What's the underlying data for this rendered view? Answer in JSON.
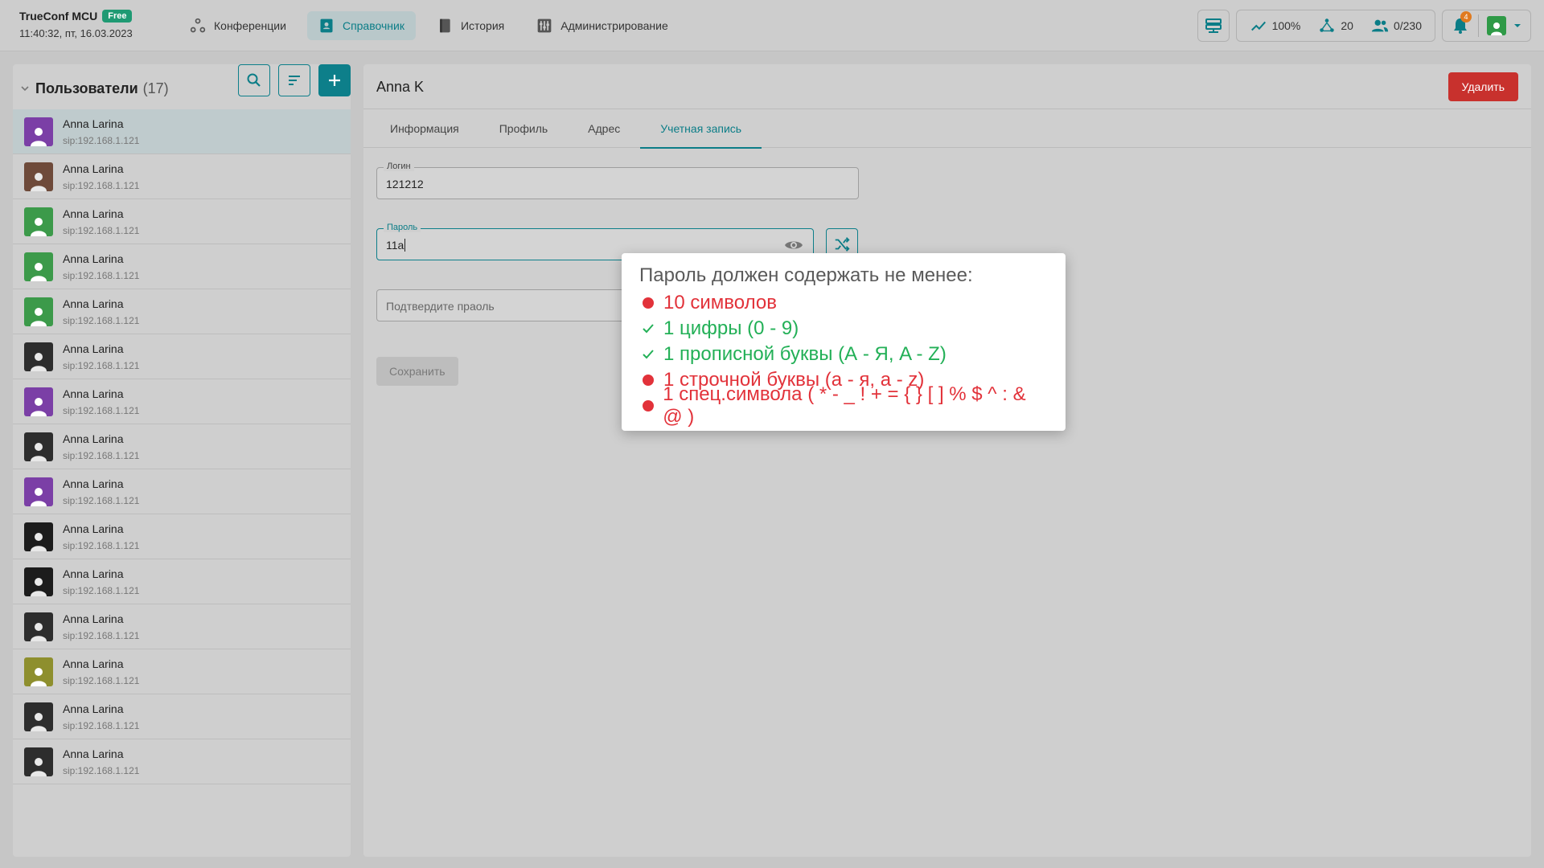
{
  "header": {
    "app_name": "TrueConf MCU",
    "badge": "Free",
    "datetime": "11:40:32, пт, 16.03.2023",
    "nav": [
      {
        "label": "Конференции",
        "icon": "conference-icon",
        "active": false
      },
      {
        "label": "Справочник",
        "icon": "address-book-icon",
        "active": true
      },
      {
        "label": "История",
        "icon": "history-book-icon",
        "active": false
      },
      {
        "label": "Администрирование",
        "icon": "admin-sliders-icon",
        "active": false
      }
    ],
    "stats": {
      "load": "100%",
      "connections": "20",
      "users": "0/230"
    },
    "notifications_count": "4"
  },
  "sidebar": {
    "title": "Пользователи",
    "count": "(17)",
    "users": [
      {
        "name": "Anna Larina",
        "sip": "sip:192.168.1.121",
        "avatar": "purple"
      },
      {
        "name": "Anna Larina",
        "sip": "sip:192.168.1.121",
        "avatar": "photo-brown"
      },
      {
        "name": "Anna Larina",
        "sip": "sip:192.168.1.121",
        "avatar": "green"
      },
      {
        "name": "Anna Larina",
        "sip": "sip:192.168.1.121",
        "avatar": "green"
      },
      {
        "name": "Anna Larina",
        "sip": "sip:192.168.1.121",
        "avatar": "green"
      },
      {
        "name": "Anna Larina",
        "sip": "sip:192.168.1.121",
        "avatar": "photo-bw"
      },
      {
        "name": "Anna Larina",
        "sip": "sip:192.168.1.121",
        "avatar": "purple"
      },
      {
        "name": "Anna Larina",
        "sip": "sip:192.168.1.121",
        "avatar": "photo-bw"
      },
      {
        "name": "Anna Larina",
        "sip": "sip:192.168.1.121",
        "avatar": "purple"
      },
      {
        "name": "Anna Larina",
        "sip": "sip:192.168.1.121",
        "avatar": "photo-dark"
      },
      {
        "name": "Anna Larina",
        "sip": "sip:192.168.1.121",
        "avatar": "photo-dark"
      },
      {
        "name": "Anna Larina",
        "sip": "sip:192.168.1.121",
        "avatar": "photo-bw"
      },
      {
        "name": "Anna Larina",
        "sip": "sip:192.168.1.121",
        "avatar": "olive"
      },
      {
        "name": "Anna Larina",
        "sip": "sip:192.168.1.121",
        "avatar": "photo-bw"
      },
      {
        "name": "Anna Larina",
        "sip": "sip:192.168.1.121",
        "avatar": "photo-bw"
      }
    ]
  },
  "detail": {
    "title": "Anna K",
    "delete_label": "Удалить",
    "tabs": [
      "Информация",
      "Профиль",
      "Адрес",
      "Учетная запись"
    ],
    "active_tab": 3,
    "login": {
      "label": "Логин",
      "value": "121212"
    },
    "password": {
      "label": "Пароль",
      "value": "11a"
    },
    "confirm": {
      "placeholder": "Подтвердите праоль"
    },
    "save_label": "Сохранить"
  },
  "password_rules": {
    "title": "Пароль должен содержать не менее:",
    "rules": [
      {
        "text": "10 символов",
        "ok": false
      },
      {
        "text": "1 цифры (0 - 9)",
        "ok": true
      },
      {
        "text": "1 прописной буквы (А - Я, A - Z)",
        "ok": true
      },
      {
        "text": "1 строчной буквы (а - я, a - z)",
        "ok": false
      },
      {
        "text": "1 спец.символа ( * - _ ! + = { } [ ] % $ ^ : & @ )",
        "ok": false
      }
    ]
  },
  "colors": {
    "accent": "#0b7d87",
    "danger": "#c8312d",
    "rule_fail": "#e2323a",
    "rule_ok": "#23b057"
  }
}
